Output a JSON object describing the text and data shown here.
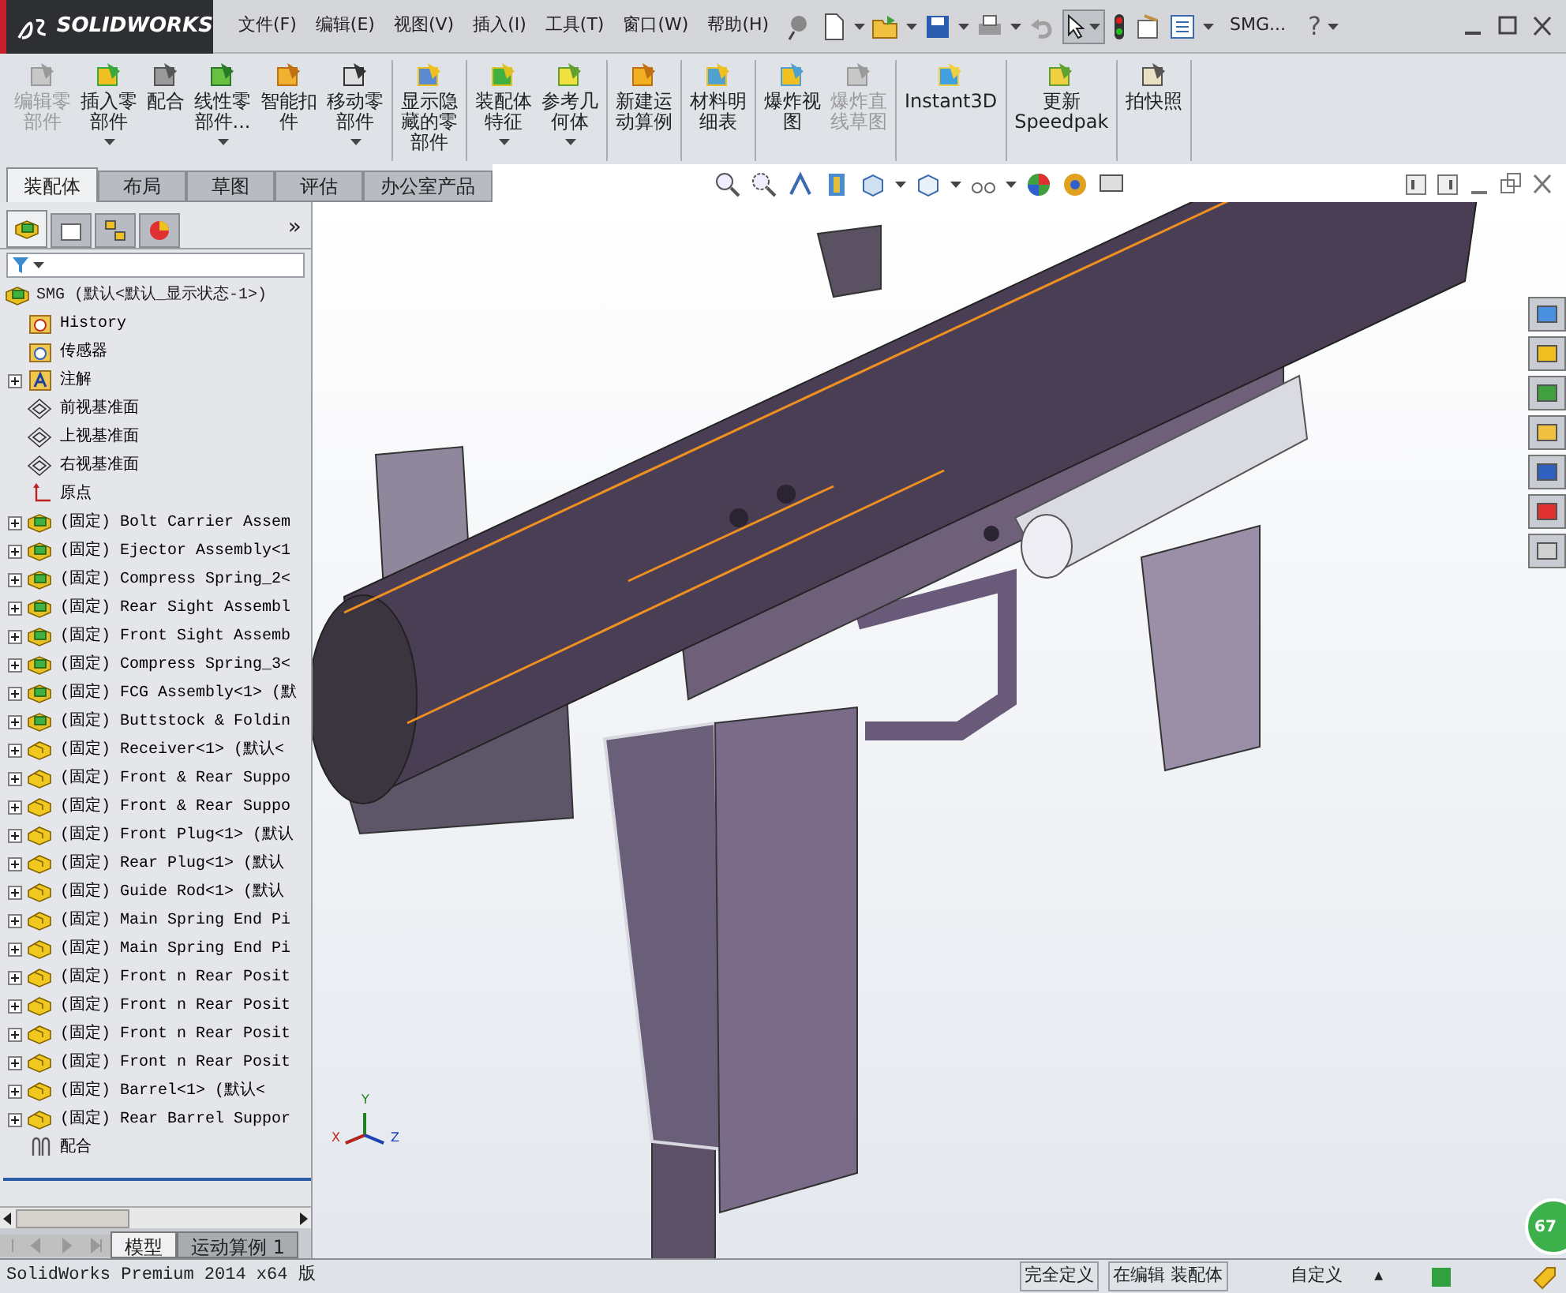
{
  "logo": {
    "text": "SOLIDWORKS"
  },
  "menu": [
    "文件(F)",
    "编辑(E)",
    "视图(V)",
    "插入(I)",
    "工具(T)",
    "窗口(W)",
    "帮助(H)"
  ],
  "document_title": "SMG...",
  "help": "?",
  "command_groups": [
    [
      {
        "kind": "edit",
        "label": [
          "编辑零",
          "部件"
        ],
        "disabled": true,
        "dropdown": false
      },
      {
        "kind": "insert",
        "label": [
          "插入零",
          "部件"
        ],
        "disabled": false,
        "dropdown": true
      },
      {
        "kind": "mate",
        "label": [
          "配合"
        ],
        "disabled": false,
        "dropdown": false
      },
      {
        "kind": "pattern",
        "label": [
          "线性零",
          "部件..."
        ],
        "disabled": false,
        "dropdown": true
      },
      {
        "kind": "fastener",
        "label": [
          "智能扣",
          "件"
        ],
        "disabled": false,
        "dropdown": false
      },
      {
        "kind": "move",
        "label": [
          "移动零",
          "部件"
        ],
        "disabled": false,
        "dropdown": true
      }
    ],
    [
      {
        "kind": "show",
        "label": [
          "显示隐",
          "藏的零",
          "部件"
        ],
        "disabled": false,
        "dropdown": false
      }
    ],
    [
      {
        "kind": "feature",
        "label": [
          "装配体",
          "特征"
        ],
        "disabled": false,
        "dropdown": true
      },
      {
        "kind": "geometry",
        "label": [
          "参考几",
          "何体"
        ],
        "disabled": false,
        "dropdown": true
      }
    ],
    [
      {
        "kind": "motion",
        "label": [
          "新建运",
          "动算例"
        ],
        "disabled": false,
        "dropdown": false
      }
    ],
    [
      {
        "kind": "bom",
        "label": [
          "材料明",
          "细表"
        ],
        "disabled": false,
        "dropdown": false
      }
    ],
    [
      {
        "kind": "explode",
        "label": [
          "爆炸视",
          "图"
        ],
        "disabled": false,
        "dropdown": false
      },
      {
        "kind": "explode",
        "label": [
          "爆炸直",
          "线草图"
        ],
        "disabled": true,
        "dropdown": false
      }
    ],
    [
      {
        "kind": "instant3d",
        "label": [
          "Instant3D"
        ],
        "disabled": false,
        "dropdown": false
      }
    ],
    [
      {
        "kind": "speedpak",
        "label": [
          "更新",
          "Speedpak"
        ],
        "disabled": false,
        "dropdown": false
      }
    ],
    [
      {
        "kind": "snapshot",
        "label": [
          "拍快照"
        ],
        "disabled": false,
        "dropdown": false
      }
    ]
  ],
  "tabs": [
    {
      "label": "装配体",
      "selected": true
    },
    {
      "label": "布局",
      "selected": false
    },
    {
      "label": "草图",
      "selected": false
    },
    {
      "label": "评估",
      "selected": false
    },
    {
      "label": "办公室产品",
      "selected": false
    }
  ],
  "panel_more": "»",
  "tree": {
    "label": "SMG  (默认<默认_显示状态-1>)",
    "kind": "assembly",
    "children": [
      {
        "label": "History",
        "kind": "history",
        "expandable": false
      },
      {
        "label": "传感器",
        "kind": "sensor",
        "expandable": false
      },
      {
        "label": "注解",
        "kind": "annotation",
        "expandable": true
      },
      {
        "label": "前视基准面",
        "kind": "plane",
        "expandable": false
      },
      {
        "label": "上视基准面",
        "kind": "plane",
        "expandable": false
      },
      {
        "label": "右视基准面",
        "kind": "plane",
        "expandable": false
      },
      {
        "label": "原点",
        "kind": "origin",
        "expandable": false
      },
      {
        "label": "(固定) Bolt Carrier Assem",
        "kind": "assembly",
        "expandable": true
      },
      {
        "label": "(固定) Ejector Assembly<1",
        "kind": "assembly",
        "expandable": true
      },
      {
        "label": "(固定) Compress Spring_2<",
        "kind": "assembly",
        "expandable": true
      },
      {
        "label": "(固定) Rear Sight Assembl",
        "kind": "assembly",
        "expandable": true
      },
      {
        "label": "(固定) Front Sight Assemb",
        "kind": "assembly",
        "expandable": true
      },
      {
        "label": "(固定) Compress Spring_3<",
        "kind": "assembly",
        "expandable": true
      },
      {
        "label": "(固定) FCG Assembly<1> (默",
        "kind": "assembly",
        "expandable": true
      },
      {
        "label": "(固定) Buttstock & Foldin",
        "kind": "assembly",
        "expandable": true
      },
      {
        "label": "(固定) Receiver<1> (默认<",
        "kind": "part",
        "expandable": true
      },
      {
        "label": "(固定) Front & Rear Suppo",
        "kind": "part",
        "expandable": true
      },
      {
        "label": "(固定) Front & Rear Suppo",
        "kind": "part",
        "expandable": true
      },
      {
        "label": "(固定) Front Plug<1> (默认",
        "kind": "part",
        "expandable": true
      },
      {
        "label": "(固定) Rear Plug<1> (默认",
        "kind": "part",
        "expandable": true
      },
      {
        "label": "(固定) Guide Rod<1> (默认",
        "kind": "part",
        "expandable": true
      },
      {
        "label": "(固定) Main Spring End Pi",
        "kind": "part",
        "expandable": true
      },
      {
        "label": "(固定) Main Spring End Pi",
        "kind": "part",
        "expandable": true
      },
      {
        "label": "(固定) Front n Rear Posit",
        "kind": "part",
        "expandable": true
      },
      {
        "label": "(固定) Front n Rear Posit",
        "kind": "part",
        "expandable": true
      },
      {
        "label": "(固定) Front n Rear Posit",
        "kind": "part",
        "expandable": true
      },
      {
        "label": "(固定) Front n Rear Posit",
        "kind": "part",
        "expandable": true
      },
      {
        "label": "(固定) Barrel<1> (默认<",
        "kind": "part",
        "expandable": true
      },
      {
        "label": "(固定) Rear Barrel Suppor",
        "kind": "part",
        "expandable": true
      },
      {
        "label": "配合",
        "kind": "mates",
        "expandable": false
      }
    ]
  },
  "bottom_tabs": [
    {
      "label": "模型",
      "selected": true
    },
    {
      "label": "运动算例 1",
      "selected": false
    }
  ],
  "triad": {
    "x": "X",
    "y": "Y",
    "z": "Z"
  },
  "badge": "67",
  "status_bar": {
    "product": "SolidWorks Premium 2014 x64 版",
    "state": "完全定义",
    "mode": "在编辑 装配体",
    "units": "自定义",
    "units_arrow": "▲"
  }
}
